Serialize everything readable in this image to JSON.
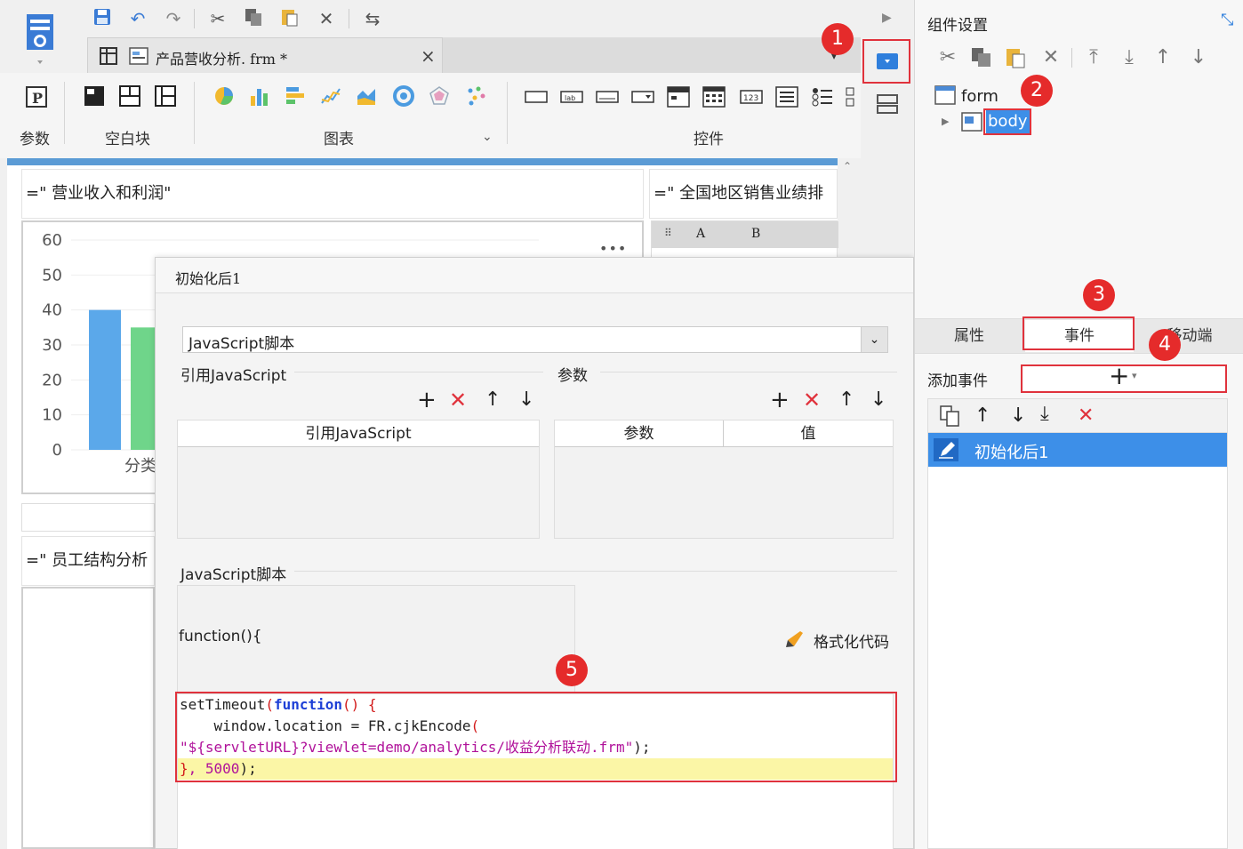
{
  "toolbar": {
    "icons": [
      "save-icon",
      "undo-icon",
      "redo-icon",
      "cut-icon",
      "copy-icon",
      "paste-icon",
      "delete-icon",
      "switch-icon"
    ]
  },
  "doc_tab": {
    "title": "产品营收分析. frm *",
    "close": "×"
  },
  "ribbon": {
    "groups": {
      "params": "参数",
      "blank": "空白块",
      "chart": "图表",
      "controls": "控件"
    }
  },
  "canvas": {
    "widget1_title": "=\"    营业收入和利润\"",
    "widget2_title": "=\"    全国地区销售业绩排",
    "widget3_title": "=\"    员工结构分析",
    "grid_col_a": "A",
    "grid_col_b": "B",
    "chart_more": "•••",
    "category_label": "分类"
  },
  "chart_data": {
    "type": "bar",
    "yticks": [
      "60",
      "50",
      "40",
      "30",
      "20",
      "10",
      "0"
    ],
    "ylim": [
      0,
      60
    ],
    "visible_values": [
      40,
      35
    ],
    "colors": [
      "#5ba8ea",
      "#6fd58a"
    ]
  },
  "dialog": {
    "title": "初始化后1",
    "type_select": "JavaScript脚本",
    "ref_js_section": "引用JavaScript",
    "ref_js_col": "引用JavaScript",
    "param_section": "参数",
    "param_col": "参数",
    "value_col": "值",
    "script_section": "JavaScript脚本",
    "func_header": "function(){",
    "format_code": "格式化代码",
    "code": {
      "line1_a": "setTimeout",
      "line1_b": "(",
      "line1_c": "function",
      "line1_d": "() {",
      "line2_a": "    window.location = FR.cjkEncode",
      "line2_b": "(",
      "line3_a": "\"${servletURL}?viewlet=demo/analytics/收益分析联动.frm\"",
      "line3_b": ");",
      "line4_a": "}",
      "line4_b": ", 5000",
      "line4_c": ");"
    }
  },
  "right_panel": {
    "title": "组件设置",
    "tree_form": "form",
    "tree_body": "body",
    "tab_properties": "属性",
    "tab_events": "事件",
    "tab_mobile": "移动端",
    "add_event_label": "添加事件",
    "add_event_button": "+",
    "event_item": "初始化后1"
  },
  "badges": [
    "1",
    "2",
    "3",
    "4",
    "5"
  ]
}
